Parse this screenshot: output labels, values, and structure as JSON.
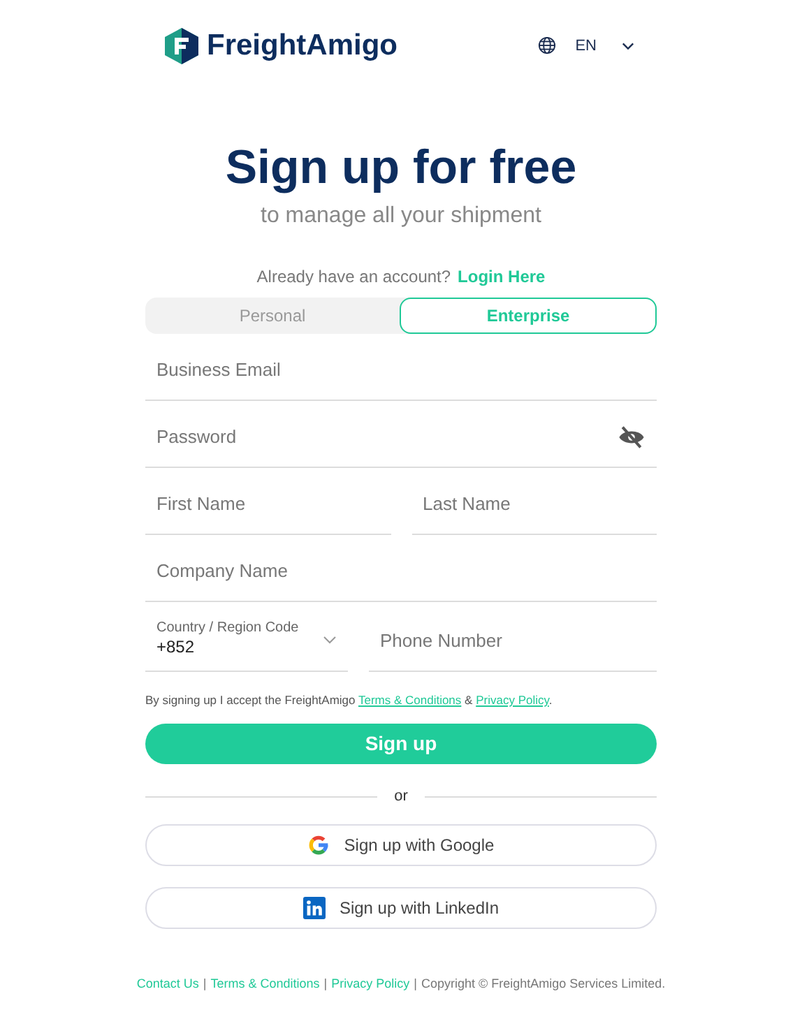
{
  "header": {
    "brand": "FreightAmigo",
    "language": "EN"
  },
  "title": "Sign up for free",
  "subtitle": "to manage all your shipment",
  "login_prompt": {
    "text": "Already have an account?",
    "link": "Login Here"
  },
  "tabs": [
    {
      "label": "Personal",
      "selected": false
    },
    {
      "label": "Enterprise",
      "selected": true
    }
  ],
  "rows": [
    {
      "fields": [
        {
          "kind": "text",
          "placeholder": "Business Email"
        }
      ]
    },
    {
      "fields": [
        {
          "kind": "password",
          "placeholder": "Password"
        }
      ]
    },
    {
      "fields": [
        {
          "kind": "text",
          "placeholder": "First Name"
        },
        {
          "kind": "text",
          "placeholder": "Last Name"
        }
      ]
    },
    {
      "fields": [
        {
          "kind": "text",
          "placeholder": "Company Name"
        }
      ]
    },
    {
      "fields": [
        {
          "kind": "select",
          "label": "Country / Region Code",
          "value": "+852"
        },
        {
          "kind": "text",
          "placeholder": "Phone Number"
        }
      ]
    }
  ],
  "consent": {
    "before": "By signing up I accept the FreightAmigo",
    "terms_link": "Terms & Conditions",
    "joiner": "&",
    "privacy_link": "Privacy Policy",
    "end": "."
  },
  "signup_button": "Sign up",
  "divider": "or",
  "social_buttons": [
    {
      "kind": "google",
      "label": "Sign up with Google"
    },
    {
      "kind": "linkedin",
      "label": "Sign up with LinkedIn"
    }
  ],
  "footer": {
    "separator": "|",
    "links": [
      "Contact Us",
      "Terms & Conditions",
      "Privacy Policy"
    ],
    "copyright": "Copyright © FreightAmigo Services Limited."
  }
}
